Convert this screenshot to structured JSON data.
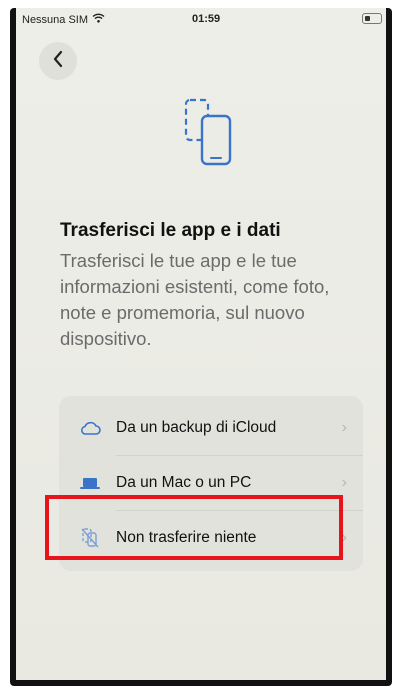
{
  "status_bar": {
    "carrier": "Nessuna SIM",
    "time": "01:59"
  },
  "header": {
    "back_icon": "chevron-left-icon"
  },
  "hero": {
    "icon": "devices-transfer-icon",
    "accent_color": "#3a74c9"
  },
  "content": {
    "title": "Trasferisci le app e i dati",
    "description": "Trasferisci le tue app e le tue informazioni esistenti, come foto, note e promemoria, sul nuovo dispositivo."
  },
  "options": [
    {
      "label": "Da un backup di iCloud",
      "icon": "cloud-icon"
    },
    {
      "label": "Da un Mac o un PC",
      "icon": "laptop-icon"
    },
    {
      "label": "Non trasferire niente",
      "icon": "no-transfer-icon"
    }
  ],
  "annotation": {
    "highlight_color": "#e8141b"
  }
}
